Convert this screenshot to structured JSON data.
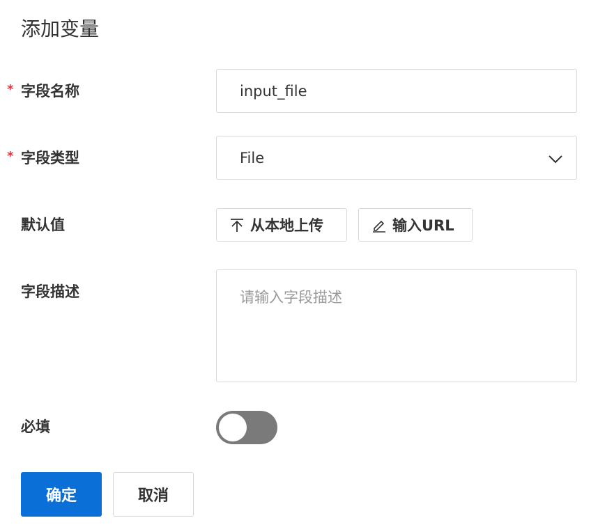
{
  "dialog": {
    "title": "添加变量"
  },
  "form": {
    "field_name": {
      "required_mark": "*",
      "label": "字段名称",
      "value": "input_file"
    },
    "field_type": {
      "required_mark": "*",
      "label": "字段类型",
      "selected": "File"
    },
    "default_value": {
      "label": "默认值",
      "upload_label": "从本地上传",
      "url_label": "输入URL"
    },
    "description": {
      "label": "字段描述",
      "placeholder": "请输入字段描述"
    },
    "required": {
      "label": "必填",
      "enabled": false
    }
  },
  "actions": {
    "confirm_label": "确定",
    "cancel_label": "取消"
  },
  "colors": {
    "primary": "#0a6fd6",
    "required_mark": "#d9363e",
    "toggle_off": "#7a7a7a"
  }
}
